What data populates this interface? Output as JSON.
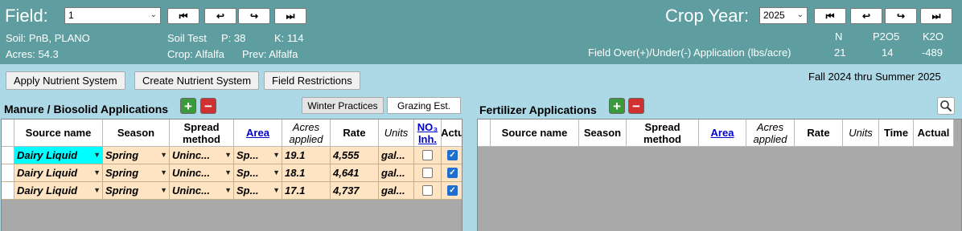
{
  "header": {
    "field_label": "Field:",
    "field_value": "1",
    "crop_year_label": "Crop Year:",
    "crop_year_value": "2025",
    "soil": "Soil: PnB, PLANO",
    "acres": "Acres: 54.3",
    "soil_test_label": "Soil Test",
    "p": "P: 38",
    "k": "K: 114",
    "crop": "Crop: Alfalfa",
    "prev": "Prev: Alfalfa",
    "nutrient_cols": [
      "N",
      "P2O5",
      "K2O"
    ],
    "balance_label": "Field Over(+)/Under(-) Application (lbs/acre)",
    "balance_values": [
      "21",
      "14",
      "-489"
    ],
    "nav_glyphs": [
      "⏮",
      "↩",
      "↪",
      "⏭"
    ]
  },
  "actions": {
    "apply": "Apply Nutrient System",
    "create": "Create Nutrient System",
    "restrictions": "Field Restrictions",
    "period": "Fall 2024 thru Summer 2025"
  },
  "manure": {
    "title": "Manure / Biosolid Applications",
    "tabs": [
      "Winter Practices",
      "Grazing Est."
    ],
    "columns": [
      "Source name",
      "Season",
      "Spread method",
      "Area",
      "Acres applied",
      "Rate",
      "Units",
      "NO₃ Inh.",
      "Actu"
    ],
    "rows": [
      {
        "source": "Dairy Liquid",
        "season": "Spring",
        "method": "Uninc...",
        "area": "Sp...",
        "acres": "19.1",
        "rate": "4,555",
        "units": "gal...",
        "no3": false,
        "actual": true
      },
      {
        "source": "Dairy Liquid",
        "season": "Spring",
        "method": "Uninc...",
        "area": "Sp...",
        "acres": "18.1",
        "rate": "4,641",
        "units": "gal...",
        "no3": false,
        "actual": true
      },
      {
        "source": "Dairy Liquid",
        "season": "Spring",
        "method": "Uninc...",
        "area": "Sp...",
        "acres": "17.1",
        "rate": "4,737",
        "units": "gal...",
        "no3": false,
        "actual": true
      }
    ]
  },
  "fertilizer": {
    "title": "Fertilizer Applications",
    "columns": [
      "Source name",
      "Season",
      "Spread method",
      "Area",
      "Acres applied",
      "Rate",
      "Units",
      "Time",
      "Actual"
    ]
  },
  "colors": {
    "header_bg": "#5f9ea0",
    "page_bg": "#add8e6",
    "row_bg": "#ffe4c4",
    "grid_empty": "#a9a9a9",
    "selected_cell": "#00ffff"
  }
}
